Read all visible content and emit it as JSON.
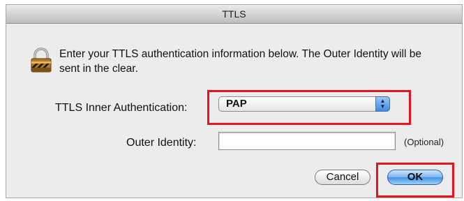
{
  "dialog": {
    "title": "TTLS",
    "message": "Enter your TTLS authentication information below. The Outer Identity will be sent in the clear.",
    "inner_auth_label": "TTLS Inner Authentication:",
    "inner_auth_value": "PAP",
    "outer_identity_label": "Outer Identity:",
    "outer_identity_value": "",
    "optional_hint": "(Optional)",
    "cancel_label": "Cancel",
    "ok_label": "OK"
  },
  "colors": {
    "highlight": "#e5141d",
    "accent": "#3f91e4"
  },
  "icons": {
    "lock": "padlock-icon",
    "popup_arrows": "up-down-arrows-icon"
  }
}
